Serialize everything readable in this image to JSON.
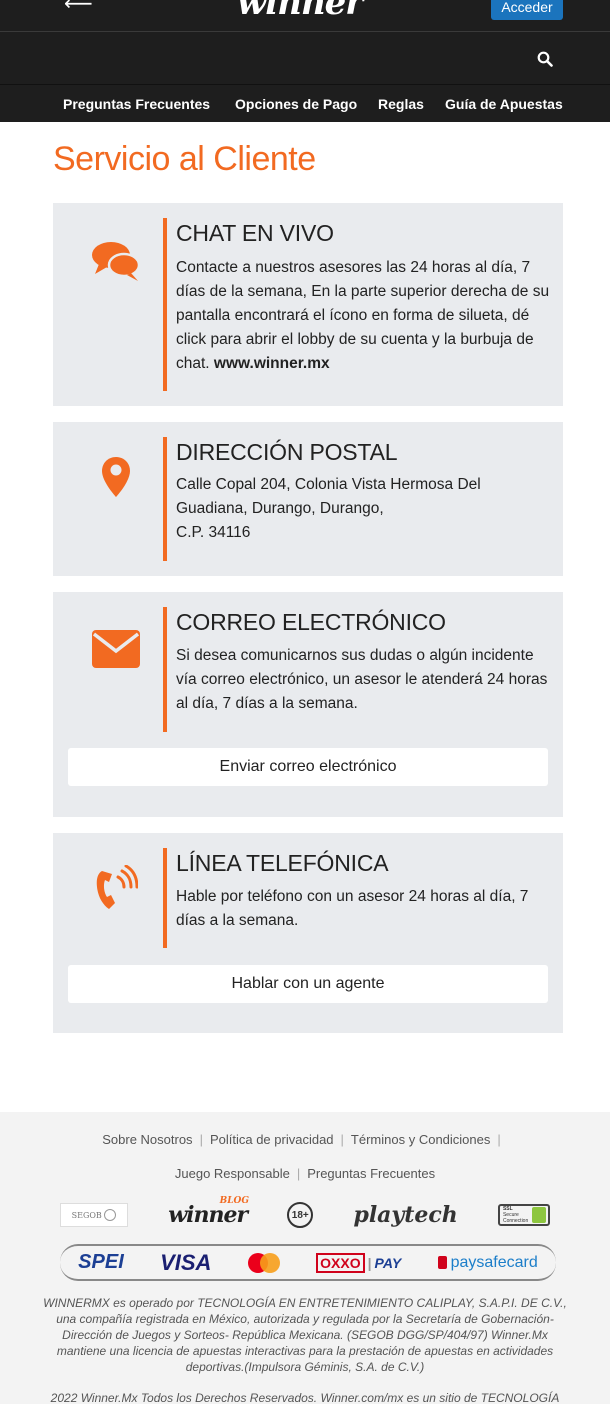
{
  "header": {
    "logo": "winner",
    "login_label": "Acceder"
  },
  "nav": {
    "items": [
      "Preguntas Frecuentes",
      "Opciones de Pago",
      "Reglas",
      "Guía de Apuestas"
    ]
  },
  "main": {
    "title": "Servicio al Cliente",
    "cards": [
      {
        "icon": "chat-bubbles-icon",
        "heading": "CHAT EN VIVO",
        "text": "Contacte a nuestros asesores las 24 horas al día, 7 días de la semana, En la parte superior derecha de su pantalla encontrará el ícono en forma de silueta, dé click para abrir el lobby de su cuenta y la burbuja de chat.",
        "link_text": "www.winner.mx"
      },
      {
        "icon": "map-pin-icon",
        "heading": "DIRECCIÓN POSTAL",
        "line1": "Calle Copal 204, Colonia Vista Hermosa Del Guadiana, Durango, Durango,",
        "line2": "C.P. 34116"
      },
      {
        "icon": "envelope-icon",
        "heading": "CORREO ELECTRÓNICO",
        "text": "Si desea comunicarnos sus dudas o algún incidente vía correo electrónico, un asesor le atenderá 24 horas al día, 7 días a la semana.",
        "button": "Enviar correo electrónico"
      },
      {
        "icon": "phone-icon",
        "heading": "LÍNEA TELEFÓNICA",
        "text": "Hable por teléfono con un asesor 24 horas al día, 7 días a la semana.",
        "button": "Hablar con un agente"
      }
    ]
  },
  "footer": {
    "links_row1": [
      "Sobre Nosotros",
      "Política de privacidad",
      "Términos y Condiciones"
    ],
    "links_row2": [
      "Juego Responsable",
      "Preguntas Frecuentes"
    ],
    "partner_logos": {
      "segob": "SEGOB",
      "winner_blog": "winner",
      "blog_tag": "BLOG",
      "age": "18+",
      "playtech": "playtech",
      "ssl_line1": "SSL",
      "ssl_line2": "Secure",
      "ssl_line3": "Connection"
    },
    "payment_logos": {
      "spei": "SPEI",
      "visa": "VISA",
      "oxxo": "OXXO",
      "pay": "PAY",
      "paysafecard": "paysafecard"
    },
    "legal": "WINNERMX es operado por TECNOLOGÍA EN ENTRETENIMIENTO CALIPLAY, S.A.P.I. DE C.V., una compañía registrada en México, autorizada y regulada por la Secretaría de Gobernación-Dirección de Juegos y Sorteos- República Mexicana. (SEGOB DGG/SP/404/97) Winner.Mx mantiene una licencia de apuestas interactivas para la prestación de apuestas en actividades deportivas.(Impulsora Géminis, S.A. de C.V.)",
    "copyright": "2022 Winner.Mx Todos los Derechos Reservados. Winner.com/mx es un sitio de TECNOLOGÍA"
  },
  "colors": {
    "accent": "#f26a21",
    "header_bg": "#1e1e1e",
    "login_bg": "#1b74bd",
    "card_bg": "#e9ebee"
  }
}
